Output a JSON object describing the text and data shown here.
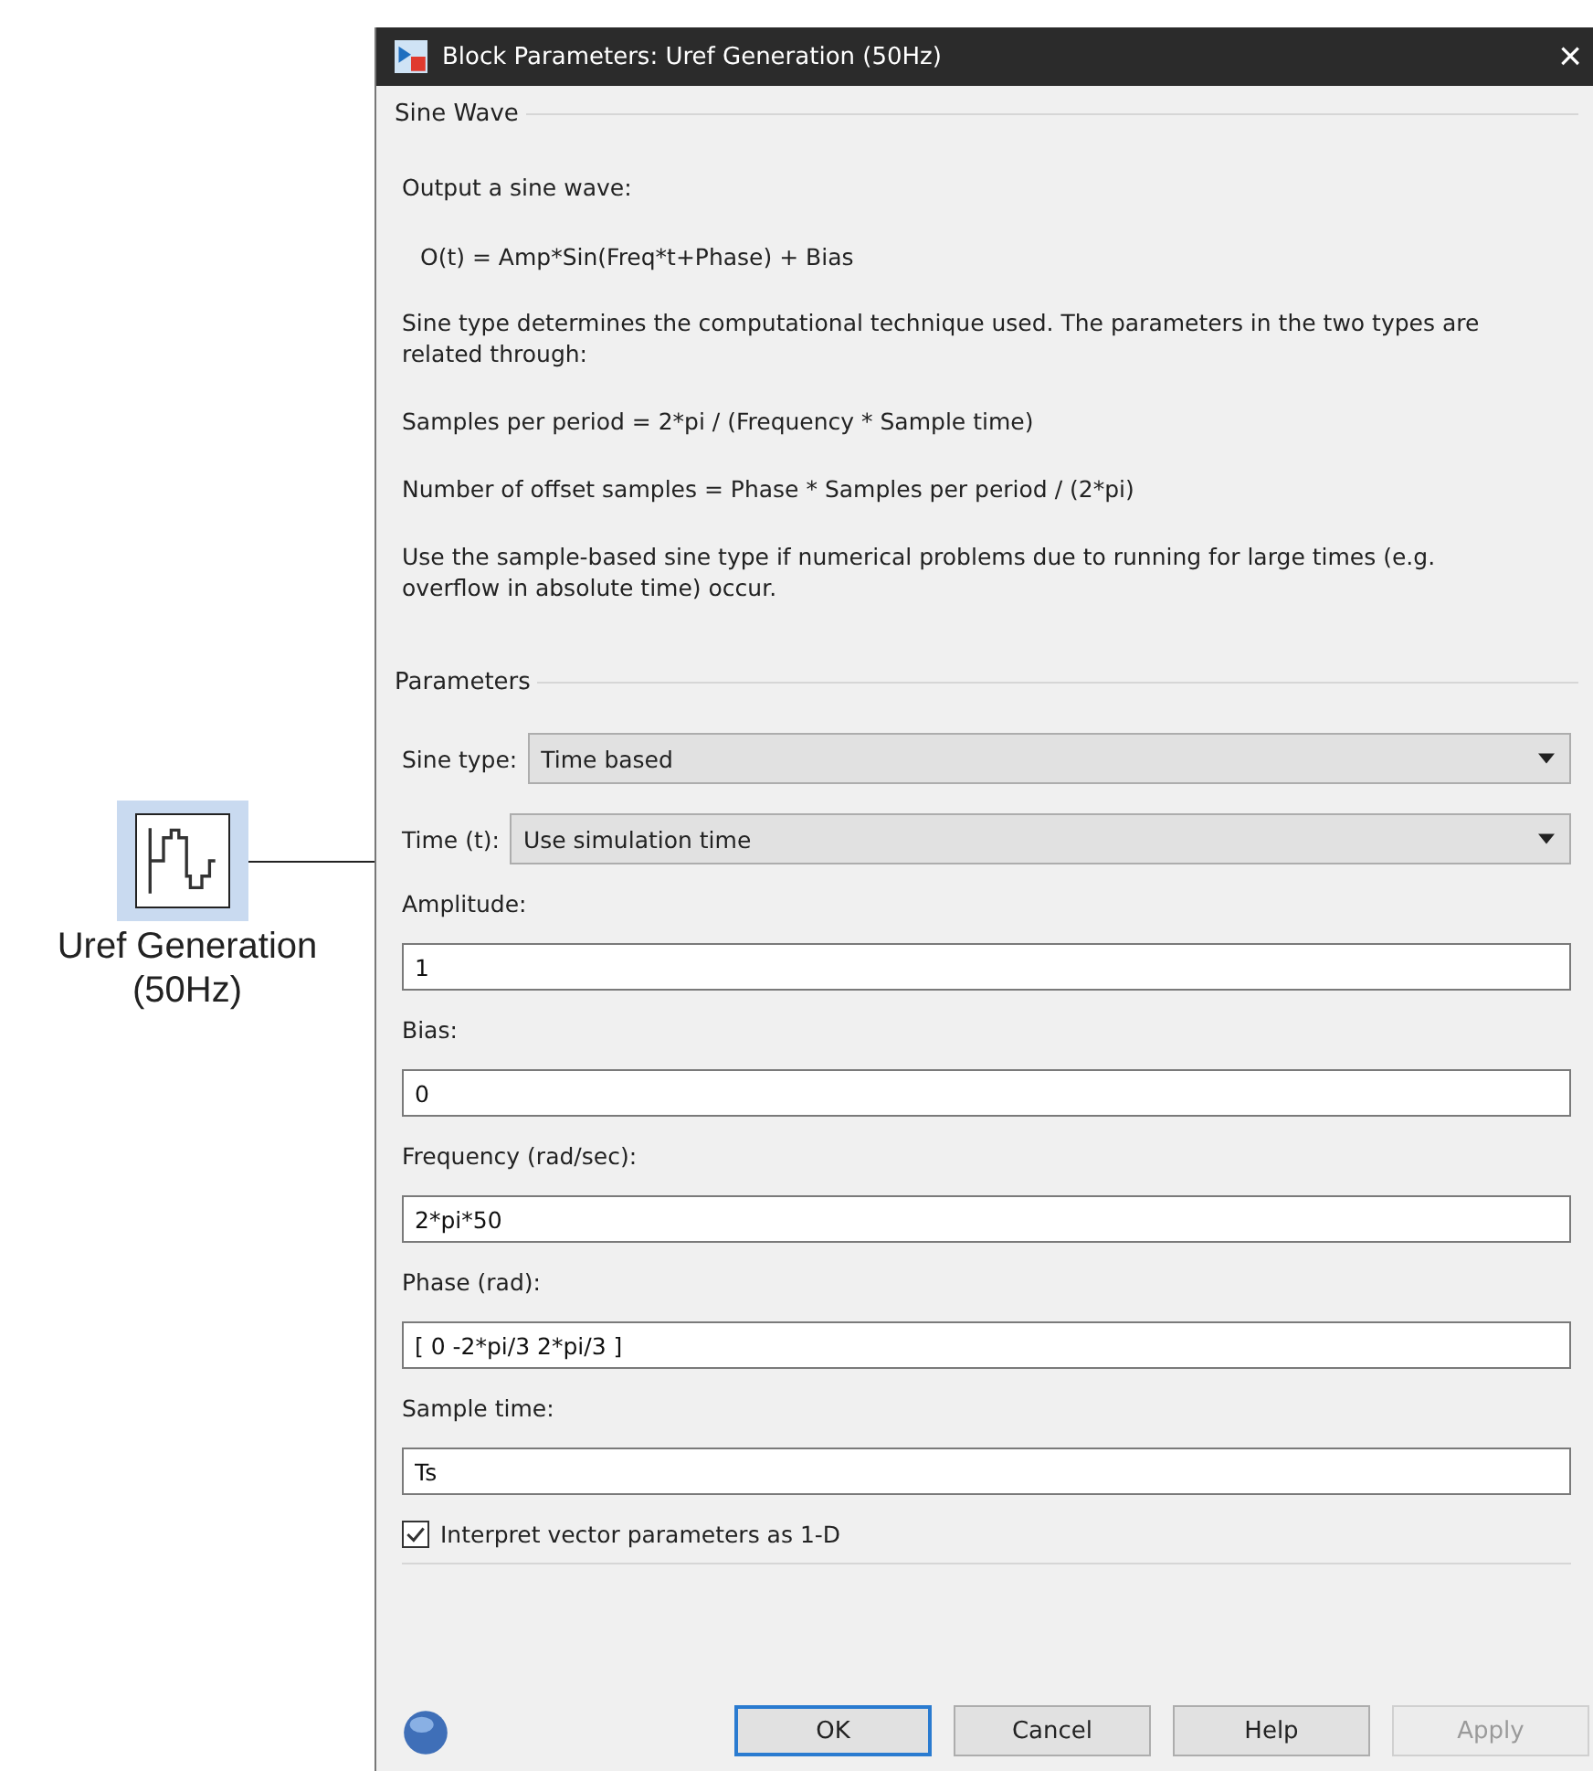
{
  "block": {
    "label": "Uref Generation (50Hz)"
  },
  "window": {
    "title": "Block Parameters: Uref Generation (50Hz)",
    "close": "×"
  },
  "description": {
    "group": "Sine Wave",
    "lines": [
      {
        "kind": "text",
        "text": "Output a sine wave:"
      },
      {
        "kind": "formula",
        "text": "O(t) = Amp*Sin(Freq*t+Phase) + Bias"
      },
      {
        "kind": "text",
        "text": "Sine type determines the computational technique used. The parameters in the two types are related through:"
      },
      {
        "kind": "text",
        "text": "Samples per period = 2*pi / (Frequency * Sample time)"
      },
      {
        "kind": "text",
        "text": "Number of offset samples = Phase * Samples per period / (2*pi)"
      },
      {
        "kind": "text",
        "text": "Use the sample-based sine type if numerical problems due to running for large times (e.g. overflow in absolute time) occur."
      }
    ]
  },
  "parameters": {
    "group": "Parameters",
    "fields": [
      {
        "kind": "dropdown",
        "label": "Sine type:",
        "value": "Time based"
      },
      {
        "kind": "dropdown",
        "label": "Time (t):",
        "value": "Use simulation time"
      },
      {
        "kind": "text",
        "label": "Amplitude:",
        "value": "1"
      },
      {
        "kind": "text",
        "label": "Bias:",
        "value": "0"
      },
      {
        "kind": "text",
        "label": "Frequency (rad/sec):",
        "value": "2*pi*50"
      },
      {
        "kind": "text",
        "label": "Phase (rad):",
        "value": "[ 0 -2*pi/3 2*pi/3 ]"
      },
      {
        "kind": "text",
        "label": "Sample time:",
        "value": "Ts"
      }
    ],
    "checkbox": {
      "label": "Interpret vector parameters as 1-D",
      "checked": true
    }
  },
  "buttons": [
    {
      "label": "OK",
      "default": true,
      "disabled": false
    },
    {
      "label": "Cancel",
      "default": false,
      "disabled": false
    },
    {
      "label": "Help",
      "default": false,
      "disabled": false
    },
    {
      "label": "Apply",
      "default": false,
      "disabled": true
    }
  ]
}
